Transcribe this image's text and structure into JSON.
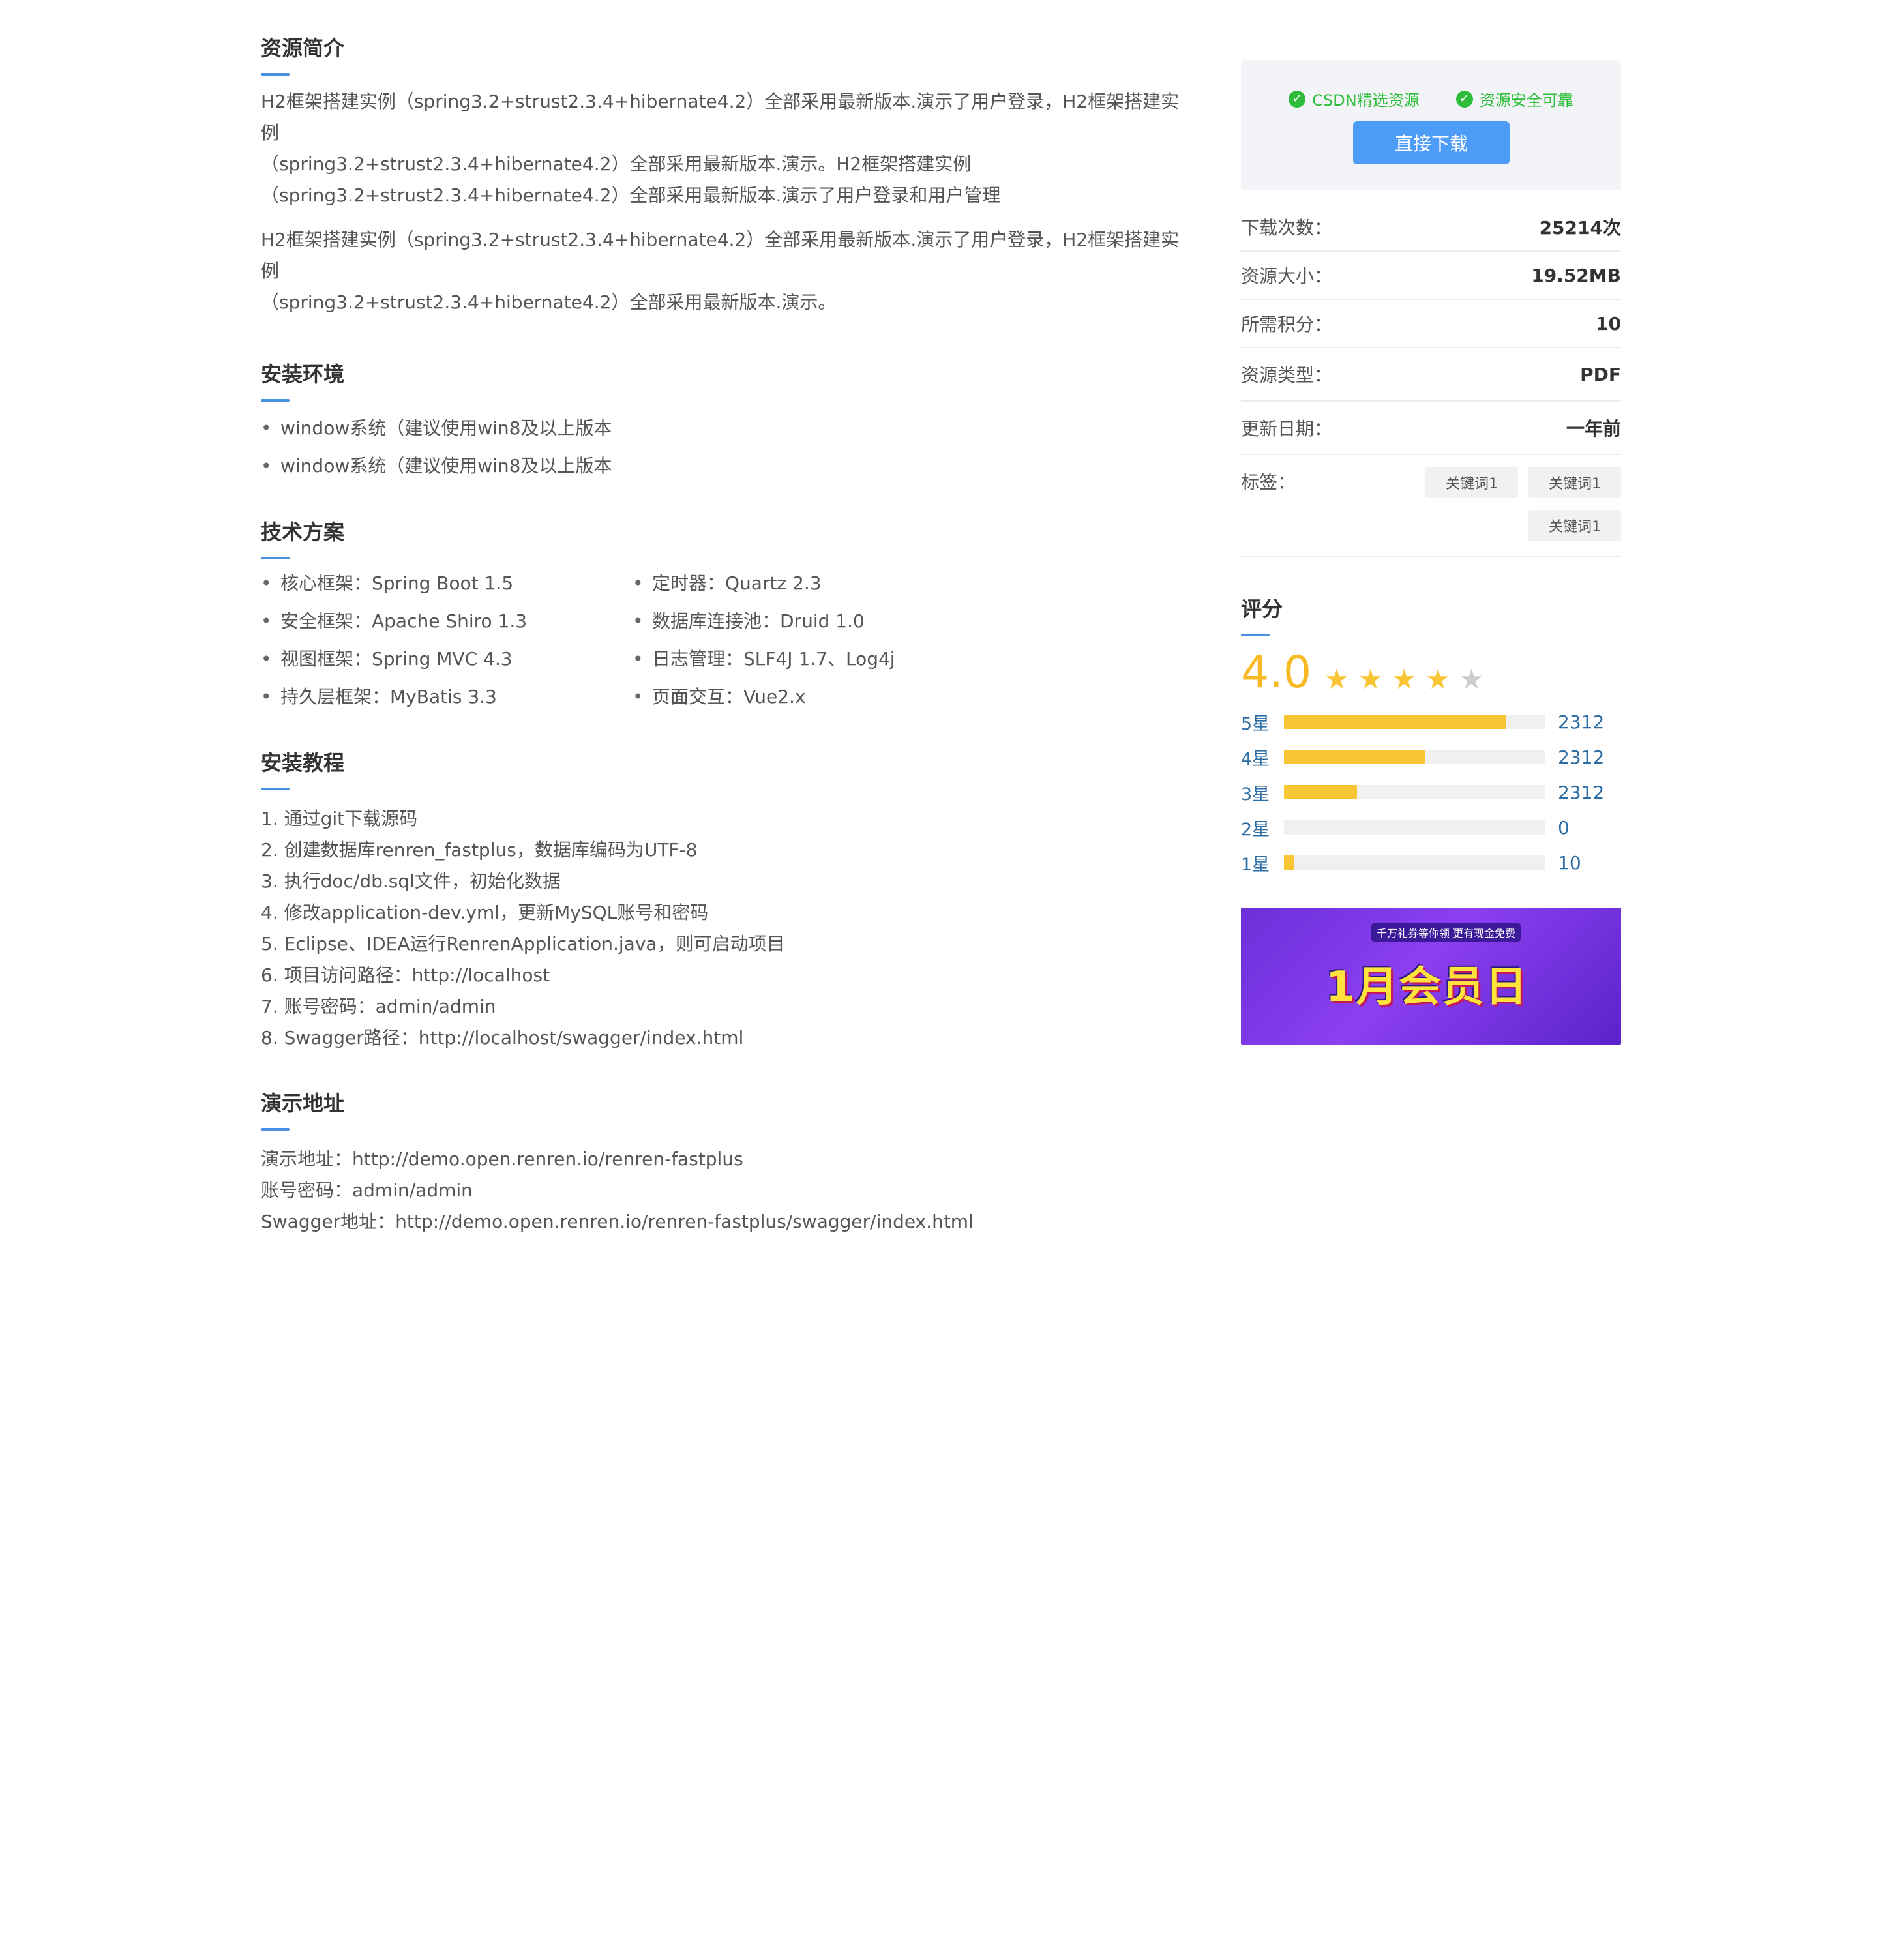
{
  "intro": {
    "title": "资源简介",
    "paragraphs": [
      [
        "H2框架搭建实例（spring3.2+strust2.3.4+hibernate4.2）全部采用最新版本.演示了用户登录，H2框架搭建实例",
        "（spring3.2+strust2.3.4+hibernate4.2）全部采用最新版本.演示。H2框架搭建实例",
        "（spring3.2+strust2.3.4+hibernate4.2）全部采用最新版本.演示了用户登录和用户管理"
      ],
      [
        "H2框架搭建实例（spring3.2+strust2.3.4+hibernate4.2）全部采用最新版本.演示了用户登录，H2框架搭建实例",
        "（spring3.2+strust2.3.4+hibernate4.2）全部采用最新版本.演示。"
      ]
    ]
  },
  "env": {
    "title": "安装环境",
    "items": [
      "window系统（建议使用win8及以上版本",
      "window系统（建议使用win8及以上版本"
    ]
  },
  "tech": {
    "title": "技术方案",
    "left": [
      "核心框架：Spring Boot 1.5",
      "安全框架：Apache Shiro 1.3",
      "视图框架：Spring MVC 4.3",
      "持久层框架：MyBatis 3.3"
    ],
    "right": [
      "定时器：Quartz 2.3",
      "数据库连接池：Druid 1.0",
      "日志管理：SLF4J 1.7、Log4j",
      "页面交互：Vue2.x"
    ]
  },
  "tutorial": {
    "title": "安装教程",
    "steps": [
      "1. 通过git下载源码",
      "2. 创建数据库renren_fastplus，数据库编码为UTF-8",
      "3. 执行doc/db.sql文件，初始化数据",
      "4. 修改application-dev.yml，更新MySQL账号和密码",
      "5. Eclipse、IDEA运行RenrenApplication.java，则可启动项目",
      "6. 项目访问路径：http://localhost",
      "7. 账号密码：admin/admin",
      "8. Swagger路径：http://localhost/swagger/index.html"
    ]
  },
  "demo": {
    "title": "演示地址",
    "lines": [
      "演示地址：http://demo.open.renren.io/renren-fastplus",
      "账号密码：admin/admin",
      "Swagger地址：http://demo.open.renren.io/renren-fastplus/swagger/index.html"
    ]
  },
  "sidebar": {
    "badges": [
      "CSDN精选资源",
      "资源安全可靠"
    ],
    "download_label": "直接下载",
    "info": [
      {
        "key": "下载次数：",
        "value": "25214次"
      },
      {
        "key": "资源大小：",
        "value": "19.52MB"
      },
      {
        "key": "所需积分：",
        "value": "10"
      },
      {
        "key": "资源类型：",
        "value": "PDF"
      },
      {
        "key": "更新日期：",
        "value": "一年前"
      }
    ],
    "tags_label": "标签：",
    "tags": [
      "关键词1",
      "关键词1",
      "关键词1"
    ],
    "rating": {
      "title": "评分",
      "score": "4.0",
      "stars_filled": 4,
      "stars_total": 5,
      "distribution": [
        {
          "label": "5星",
          "count": "2312",
          "fill": 0.85
        },
        {
          "label": "4星",
          "count": "2312",
          "fill": 0.54
        },
        {
          "label": "3星",
          "count": "2312",
          "fill": 0.28
        },
        {
          "label": "2星",
          "count": "0",
          "fill": 0.0
        },
        {
          "label": "1星",
          "count": "10",
          "fill": 0.04
        }
      ]
    },
    "banner": {
      "title": "1月会员日",
      "subtitle": "千万礼券等你领 更有现金免费"
    }
  },
  "colors": {
    "accent": "#4a90e2",
    "button": "#4d9cf8",
    "success": "#2ebd3a",
    "star": "#f8c534",
    "star_empty": "#cccccc",
    "link": "#2d6da3"
  }
}
